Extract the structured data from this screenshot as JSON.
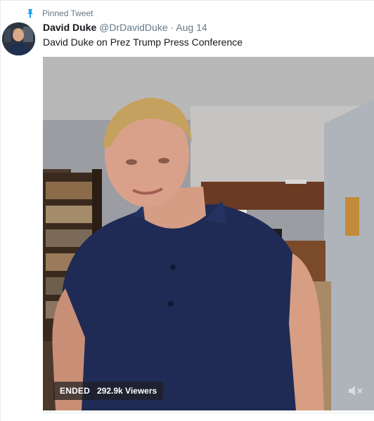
{
  "tweet": {
    "pinned_label": "Pinned Tweet",
    "display_name": "David Duke",
    "handle": "@DrDavidDuke",
    "separator": "·",
    "date": "Aug 14",
    "text": "David Duke on Prez Trump Press Conference"
  },
  "video": {
    "status": "ENDED",
    "viewers": "292.9k Viewers"
  },
  "colors": {
    "pin_accent": "#1da1f2",
    "secondary_text": "#657786",
    "primary_text": "#14171a"
  },
  "icons": {
    "pin": "pin-icon",
    "mute": "mute-icon"
  }
}
